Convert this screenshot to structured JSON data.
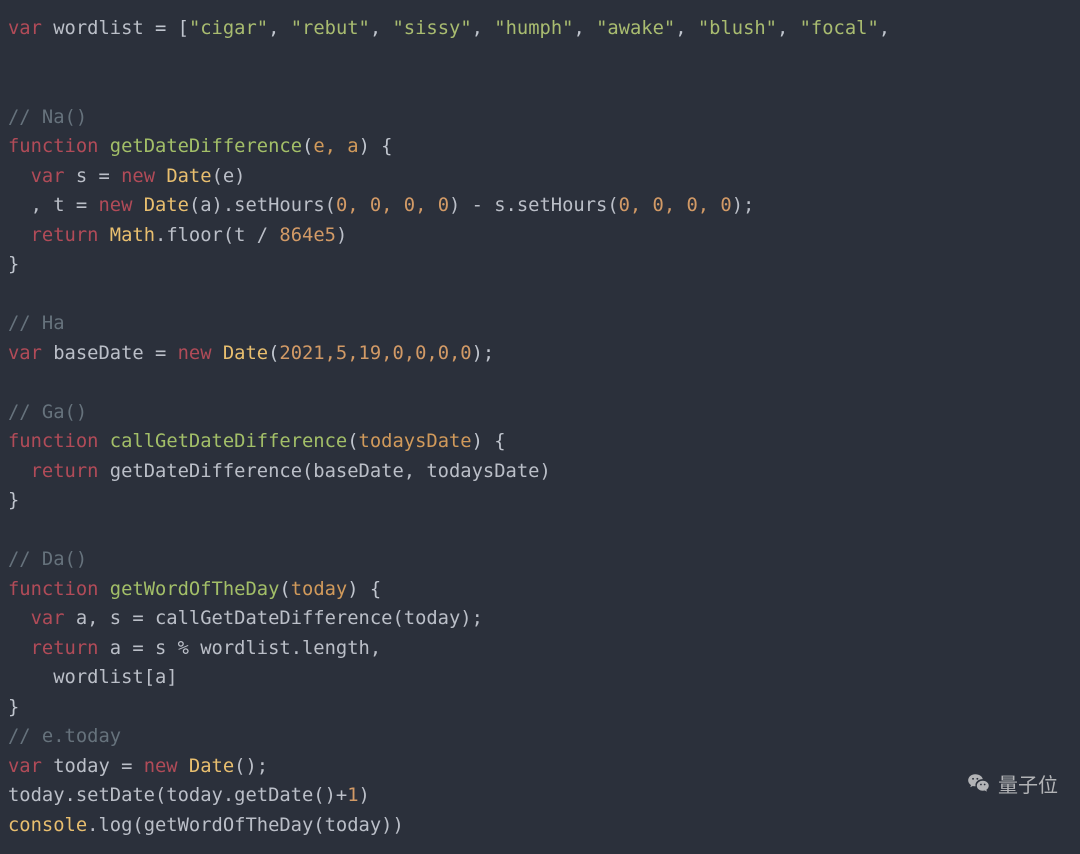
{
  "code": {
    "wordlist_decl": {
      "kw_var": "var",
      "name": "wordlist",
      "eq": " = [",
      "items": [
        "\"cigar\"",
        "\"rebut\"",
        "\"sissy\"",
        "\"humph\"",
        "\"awake\"",
        "\"blush\"",
        "\"focal\""
      ],
      "trail": ","
    },
    "comment_na": "// Na()",
    "fn1": {
      "kw_function": "function",
      "name": "getDateDifference",
      "params": "e, a",
      "body_l1_var": "var",
      "body_l1_rest_a": " s = ",
      "body_l1_new": "new",
      "body_l1_cls": " Date",
      "body_l1_call": "(e)",
      "body_l2_a": ", t = ",
      "body_l2_new": "new",
      "body_l2_cls": " Date",
      "body_l2_call1": "(a).setHours(",
      "body_l2_args": "0, 0, 0, 0",
      "body_l2_mid": ") - s.setHours(",
      "body_l2_args2": "0, 0, 0, 0",
      "body_l2_end": ");",
      "body_l3_ret": "return",
      "body_l3_math": " Math",
      "body_l3_floor": ".floor(t / ",
      "body_l3_num": "864e5",
      "body_l3_end": ")"
    },
    "comment_ha": "// Ha",
    "basedate": {
      "kw_var": "var",
      "name": " baseDate = ",
      "kw_new": "new",
      "cls": " Date",
      "args_open": "(",
      "args": "2021,5,19,0,0,0,0",
      "args_close": ");"
    },
    "comment_ga": "// Ga()",
    "fn2": {
      "kw_function": "function",
      "name": "callGetDateDifference",
      "params": "todaysDate",
      "ret": "return",
      "call": " getDateDifference(baseDate, todaysDate)"
    },
    "comment_da": "// Da()",
    "fn3": {
      "kw_function": "function",
      "name": "getWordOfTheDay",
      "params": "today",
      "l1_var": "var",
      "l1_rest": " a, s = callGetDateDifference(today);",
      "l2_ret": "return",
      "l2_rest": " a = s % wordlist.length,",
      "l3": "wordlist[a]"
    },
    "comment_etoday": "// e.today",
    "today_decl": {
      "kw_var": "var",
      "rest_a": " today = ",
      "kw_new": "new",
      "cls": " Date",
      "call": "();"
    },
    "setdate_line_a": "today.setDate(today.getDate()+",
    "setdate_num": "1",
    "setdate_line_b": ")",
    "console_a": "console",
    "console_b": ".log(getWordOfTheDay(today))"
  },
  "watermark": {
    "text": "量子位"
  }
}
